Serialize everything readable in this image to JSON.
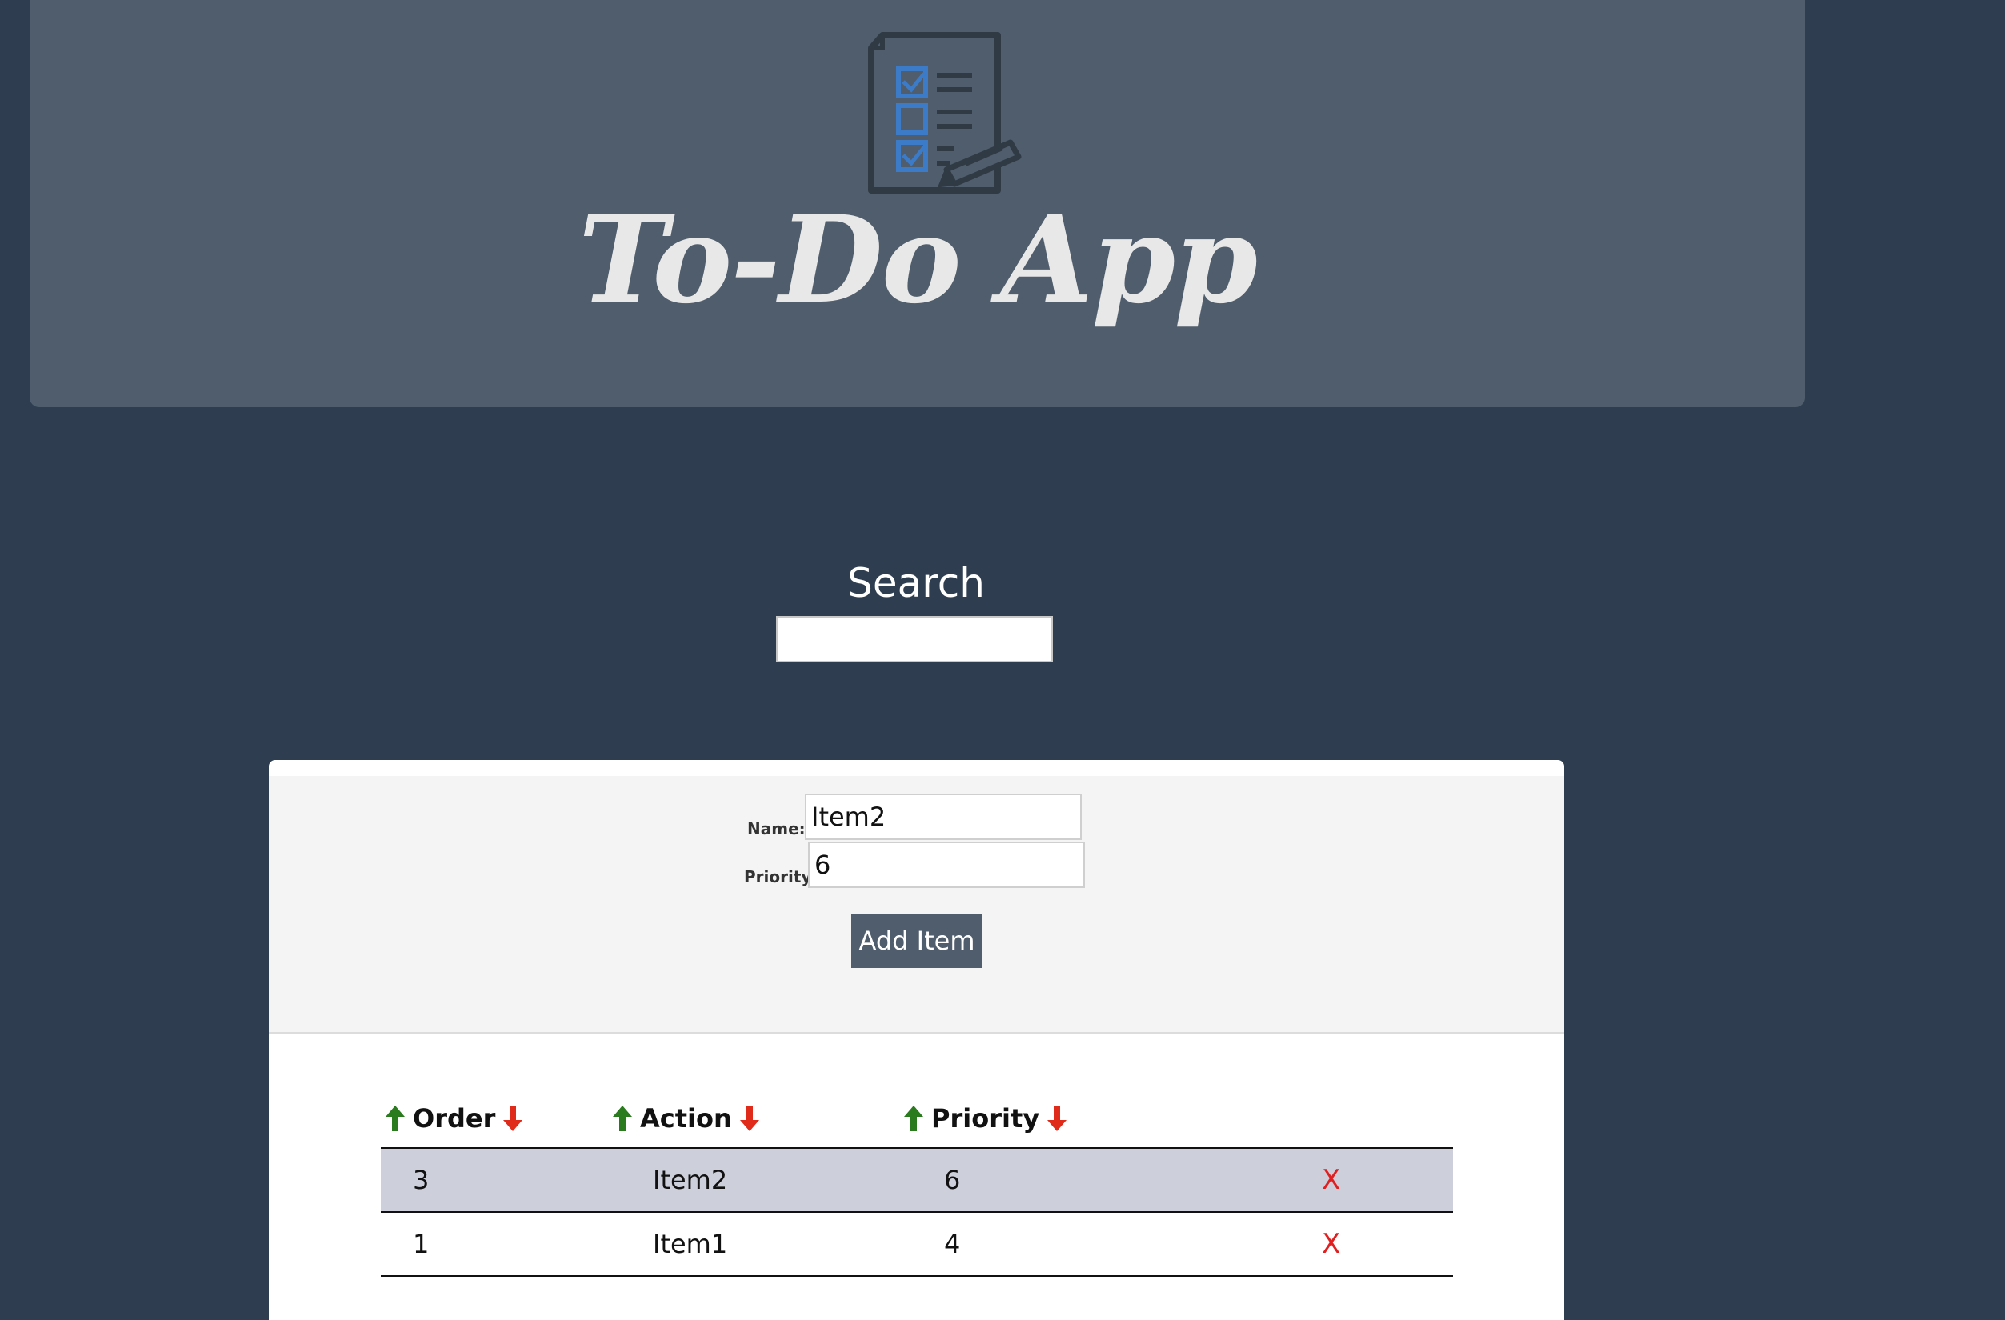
{
  "header": {
    "title": "To-Do App",
    "logo_icon": "checklist-icon"
  },
  "search": {
    "label": "Search",
    "value": ""
  },
  "form": {
    "name_label": "Name:",
    "name_value": "Item2",
    "priority_label": "Priority:",
    "priority_value": "6",
    "add_button_label": "Add Item"
  },
  "table": {
    "columns": [
      {
        "label": "Order"
      },
      {
        "label": "Action"
      },
      {
        "label": "Priority"
      }
    ],
    "rows": [
      {
        "order": "3",
        "action": "Item2",
        "priority": "6",
        "delete": "X"
      },
      {
        "order": "1",
        "action": "Item1",
        "priority": "4",
        "delete": "X"
      }
    ]
  },
  "colors": {
    "background": "#2e3e50",
    "header": "#505d6c",
    "sort_up": "#2a7a1e",
    "sort_down": "#e02a1a",
    "delete": "#e02020",
    "row_highlight": "#cdcfda",
    "logo_accent": "#3b7bc8"
  }
}
